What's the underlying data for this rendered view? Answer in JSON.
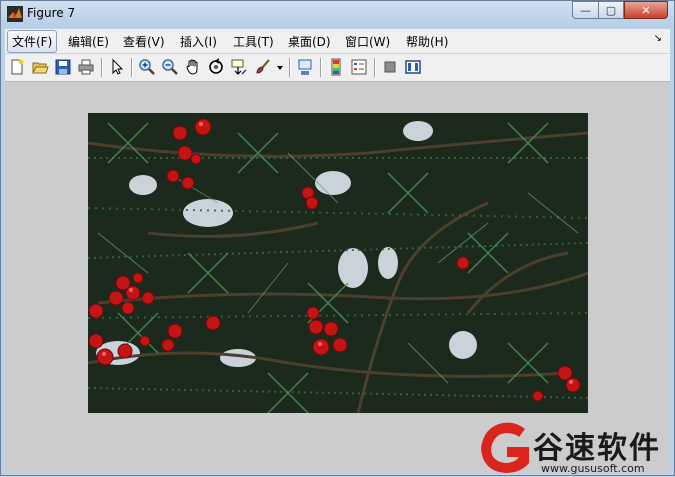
{
  "window": {
    "title": "Figure 7",
    "controls": {
      "minimize": "—",
      "maximize": "▢",
      "close": "✕"
    }
  },
  "menubar": {
    "items": [
      {
        "label": "文件(F)"
      },
      {
        "label": "编辑(E)"
      },
      {
        "label": "查看(V)"
      },
      {
        "label": "插入(I)"
      },
      {
        "label": "工具(T)"
      },
      {
        "label": "桌面(D)"
      },
      {
        "label": "窗口(W)"
      },
      {
        "label": "帮助(H)"
      }
    ],
    "overflow_arrow": "↘"
  },
  "toolbar": {
    "buttons": [
      "new-figure-icon",
      "open-file-icon",
      "save-icon",
      "print-icon",
      "edit-plot-arrow-icon",
      "zoom-in-icon",
      "zoom-out-icon",
      "pan-hand-icon",
      "rotate-3d-icon",
      "data-cursor-icon",
      "brush-icon",
      "dropdown-arrow-icon",
      "link-plot-icon",
      "insert-colorbar-icon",
      "insert-legend-icon",
      "hide-plot-tools-icon",
      "show-plot-tools-icon"
    ]
  },
  "figure": {
    "content": "Photo of evergreen branches with red berries and snow"
  },
  "watermark": {
    "brand": "谷速软件",
    "url": "www.gususoft.com"
  },
  "colors": {
    "titlebar": "#bcd2ea",
    "menubar": "#f0f0f0",
    "canvas": "#cccccc",
    "berry": "#c41414",
    "watermark_red": "#d9251d"
  }
}
